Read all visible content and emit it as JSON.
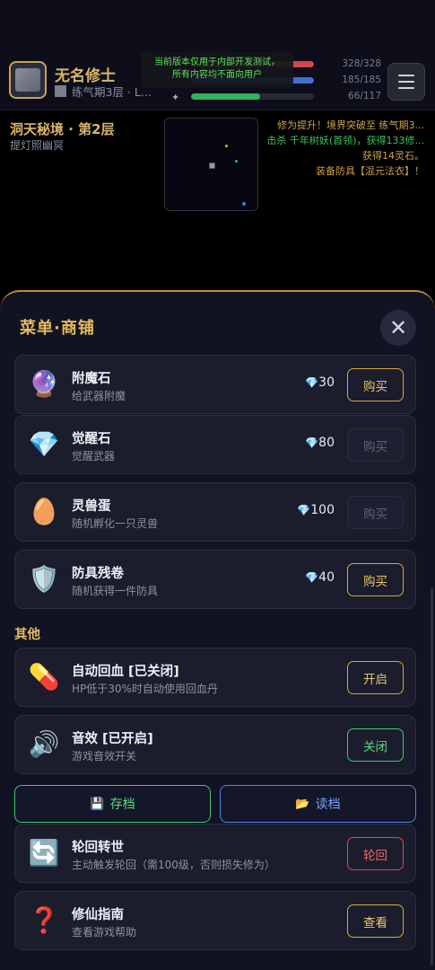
{
  "player": {
    "name": "无名修士",
    "realm": "练气期3层 · L..."
  },
  "notice": {
    "line1": "当前版本仅用于内部开发测试，",
    "line2": "所有内容均不面向用户"
  },
  "stats": {
    "hp": {
      "value": "328/328",
      "ratio": 1.0,
      "color": "#d9434b"
    },
    "mp": {
      "value": "185/185",
      "ratio": 1.0,
      "color": "#3f6fd6"
    },
    "exp": {
      "value": "66/117",
      "ratio": 0.56,
      "color": "#2fb35b",
      "icon": "sparkle-icon"
    }
  },
  "location": {
    "name": "洞天秘境 · 第2层",
    "sub": "提灯照幽冥"
  },
  "log": [
    {
      "text": "修为提升！境界突破至 练气期3...",
      "color": "#c9a24a"
    },
    {
      "text": "击杀 千年树妖(首领)，获得133修...",
      "color": "#3ec45e"
    },
    {
      "text": "获得14灵石。",
      "color": "#c9a24a"
    },
    {
      "text": "装备防具【混元法衣】！",
      "color": "#c9a24a"
    }
  ],
  "panel": {
    "title": "菜单·商铺",
    "close_icon": "close-icon"
  },
  "shop_items": [
    {
      "icon": "crystal-ball-icon",
      "glyph": "🔮",
      "name": "附魔石",
      "desc": "给武器附魔",
      "price": "30",
      "button": "购买",
      "state": "gold"
    },
    {
      "icon": "diamond-icon",
      "glyph": "💎",
      "name": "觉醒石",
      "desc": "觉醒武器",
      "price": "80",
      "button": "购买",
      "state": "dis"
    },
    {
      "icon": "egg-icon",
      "glyph": "🥚",
      "name": "灵兽蛋",
      "desc": "随机孵化一只灵兽",
      "price": "100",
      "button": "购买",
      "state": "dis"
    },
    {
      "icon": "shield-icon",
      "glyph": "🛡️",
      "name": "防具残卷",
      "desc": "随机获得一件防具",
      "price": "40",
      "button": "购买",
      "state": "gold"
    }
  ],
  "section_other": "其他",
  "other_items": [
    {
      "icon": "pill-icon",
      "glyph": "💊",
      "name": "自动回血 [已关闭]",
      "desc": "HP低于30%时自动使用回血丹",
      "button": "开启",
      "state": "gold"
    },
    {
      "icon": "speaker-icon",
      "glyph": "🔊",
      "name": "音效 [已开启]",
      "desc": "游戏音效开关",
      "button": "关闭",
      "state": "green"
    }
  ],
  "save_button": {
    "icon": "floppy-icon",
    "glyph": "💾",
    "label": "存档"
  },
  "load_button": {
    "icon": "folder-icon",
    "glyph": "📂",
    "label": "读档"
  },
  "rebirth": {
    "icon": "cycle-icon",
    "glyph": "🔄",
    "name": "轮回转世",
    "desc": "主动触发轮回（需100级，否则损失修为）",
    "button": "轮回",
    "state": "red"
  },
  "guide": {
    "icon": "question-icon",
    "glyph": "❓",
    "name": "修仙指南",
    "desc": "查看游戏帮助",
    "button": "查看",
    "state": "gold"
  },
  "gem_icon": "💎"
}
